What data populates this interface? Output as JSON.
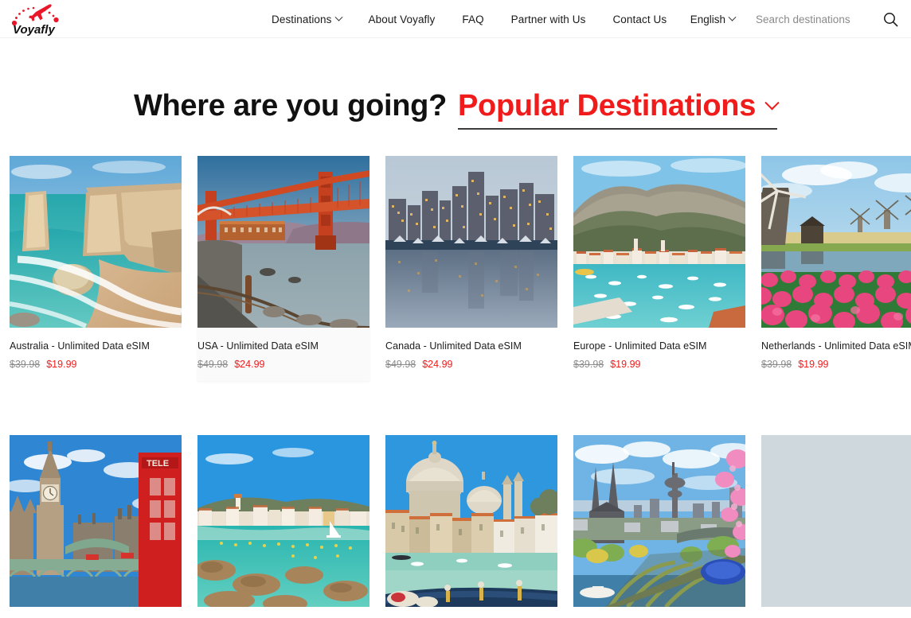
{
  "brand": {
    "name": "Voyafly",
    "logo_icon": "airplane-dotted-trail-icon",
    "color": "#e8172a"
  },
  "header": {
    "nav": [
      {
        "label": "Destinations",
        "has_dropdown": true
      },
      {
        "label": "About Voyafly",
        "has_dropdown": false
      },
      {
        "label": "FAQ",
        "has_dropdown": false
      },
      {
        "label": "Partner with Us",
        "has_dropdown": false
      },
      {
        "label": "Contact Us",
        "has_dropdown": false
      }
    ],
    "language": {
      "label": "English",
      "has_dropdown": true
    },
    "search": {
      "placeholder": "Search destinations",
      "value": "",
      "icon": "search-icon"
    }
  },
  "hero": {
    "question": "Where are you going?",
    "filter_label": "Popular Destinations",
    "filter_icon": "chevron-down-icon",
    "accent_color": "#f01b1b"
  },
  "products": [
    {
      "title": "Australia - Unlimited Data eSIM",
      "price_old": "$39.98",
      "price_new": "$19.99",
      "image_alt": "twelve-apostles-limestone-cliffs-turquoise-ocean-beach",
      "hovered": false
    },
    {
      "title": "USA - Unlimited Data eSIM",
      "price_old": "$49.98",
      "price_new": "$24.99",
      "image_alt": "golden-gate-bridge-sunset-chain-fence",
      "hovered": true
    },
    {
      "title": "Canada - Unlimited Data eSIM",
      "price_old": "$49.98",
      "price_new": "$24.99",
      "image_alt": "vancouver-skyline-dusk-marina-reflection",
      "hovered": false
    },
    {
      "title": "Europe - Unlimited Data eSIM",
      "price_old": "$39.98",
      "price_new": "$19.99",
      "image_alt": "adriatic-coastal-town-mountains-harbor-boats",
      "hovered": false
    },
    {
      "title": "Netherlands - Unlimited Data eSIM",
      "price_old": "$39.98",
      "price_new": "$19.99",
      "image_alt": "dutch-windmills-canal-pink-tulip-field",
      "hovered": false
    }
  ],
  "products_row2": [
    {
      "image_alt": "london-big-ben-westminster-bridge-red-telephone-box"
    },
    {
      "image_alt": "costa-brava-village-turquoise-bay-sailboat"
    },
    {
      "image_alt": "venice-grand-canal-santa-maria-della-salute-gondola"
    },
    {
      "image_alt": "cologne-cathedral-hohenzollern-bridge-cherry-blossom"
    }
  ]
}
